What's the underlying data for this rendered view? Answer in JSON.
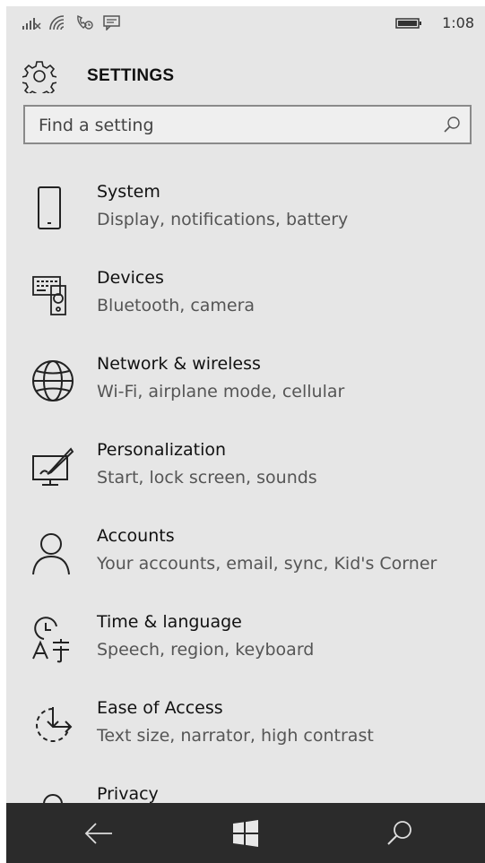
{
  "status_bar": {
    "icons": [
      "signal-bars-icon",
      "wifi-icon",
      "phone-call-icon",
      "message-icon"
    ],
    "battery_icon": "battery-icon",
    "time": "1:08"
  },
  "header": {
    "icon": "gear-icon",
    "title": "SETTINGS"
  },
  "search": {
    "placeholder": "Find a setting",
    "icon": "search-icon"
  },
  "items": [
    {
      "icon": "phone-device-icon",
      "title": "System",
      "subtitle": "Display, notifications, battery"
    },
    {
      "icon": "devices-icon",
      "title": "Devices",
      "subtitle": "Bluetooth, camera"
    },
    {
      "icon": "globe-icon",
      "title": "Network & wireless",
      "subtitle": "Wi-Fi, airplane mode, cellular"
    },
    {
      "icon": "personalization-icon",
      "title": "Personalization",
      "subtitle": "Start, lock screen, sounds"
    },
    {
      "icon": "person-icon",
      "title": "Accounts",
      "subtitle": "Your accounts, email, sync, Kid's Corner"
    },
    {
      "icon": "time-language-icon",
      "title": "Time & language",
      "subtitle": "Speech, region, keyboard"
    },
    {
      "icon": "ease-of-access-icon",
      "title": "Ease of Access",
      "subtitle": "Text size, narrator, high contrast"
    },
    {
      "icon": "privacy-icon",
      "title": "Privacy",
      "subtitle": ""
    }
  ],
  "nav_bar": {
    "back_icon": "back-arrow-icon",
    "start_icon": "windows-logo-icon",
    "search_icon": "search-icon"
  },
  "colors": {
    "background": "#e6e6e6",
    "navbar": "#2b2b2b",
    "text_primary": "#111111",
    "text_secondary": "#555555"
  }
}
